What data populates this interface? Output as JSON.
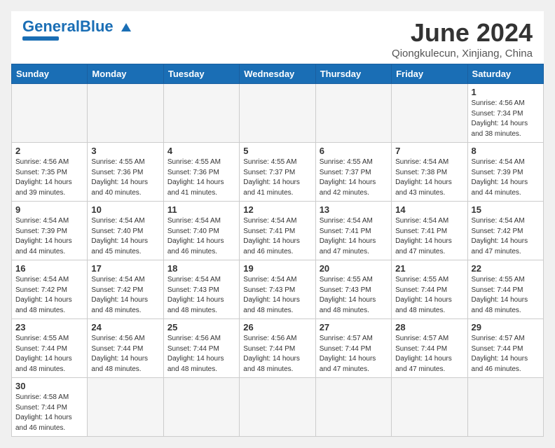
{
  "header": {
    "logo_general": "General",
    "logo_blue": "Blue",
    "title": "June 2024",
    "location": "Qiongkulecun, Xinjiang, China"
  },
  "weekdays": [
    "Sunday",
    "Monday",
    "Tuesday",
    "Wednesday",
    "Thursday",
    "Friday",
    "Saturday"
  ],
  "weeks": [
    [
      {
        "day": "",
        "info": ""
      },
      {
        "day": "",
        "info": ""
      },
      {
        "day": "",
        "info": ""
      },
      {
        "day": "",
        "info": ""
      },
      {
        "day": "",
        "info": ""
      },
      {
        "day": "",
        "info": ""
      },
      {
        "day": "1",
        "info": "Sunrise: 4:56 AM\nSunset: 7:34 PM\nDaylight: 14 hours\nand 38 minutes."
      }
    ],
    [
      {
        "day": "2",
        "info": "Sunrise: 4:56 AM\nSunset: 7:35 PM\nDaylight: 14 hours\nand 39 minutes."
      },
      {
        "day": "3",
        "info": "Sunrise: 4:55 AM\nSunset: 7:36 PM\nDaylight: 14 hours\nand 40 minutes."
      },
      {
        "day": "4",
        "info": "Sunrise: 4:55 AM\nSunset: 7:36 PM\nDaylight: 14 hours\nand 41 minutes."
      },
      {
        "day": "5",
        "info": "Sunrise: 4:55 AM\nSunset: 7:37 PM\nDaylight: 14 hours\nand 41 minutes."
      },
      {
        "day": "6",
        "info": "Sunrise: 4:55 AM\nSunset: 7:37 PM\nDaylight: 14 hours\nand 42 minutes."
      },
      {
        "day": "7",
        "info": "Sunrise: 4:54 AM\nSunset: 7:38 PM\nDaylight: 14 hours\nand 43 minutes."
      },
      {
        "day": "8",
        "info": "Sunrise: 4:54 AM\nSunset: 7:39 PM\nDaylight: 14 hours\nand 44 minutes."
      }
    ],
    [
      {
        "day": "9",
        "info": "Sunrise: 4:54 AM\nSunset: 7:39 PM\nDaylight: 14 hours\nand 44 minutes."
      },
      {
        "day": "10",
        "info": "Sunrise: 4:54 AM\nSunset: 7:40 PM\nDaylight: 14 hours\nand 45 minutes."
      },
      {
        "day": "11",
        "info": "Sunrise: 4:54 AM\nSunset: 7:40 PM\nDaylight: 14 hours\nand 46 minutes."
      },
      {
        "day": "12",
        "info": "Sunrise: 4:54 AM\nSunset: 7:41 PM\nDaylight: 14 hours\nand 46 minutes."
      },
      {
        "day": "13",
        "info": "Sunrise: 4:54 AM\nSunset: 7:41 PM\nDaylight: 14 hours\nand 47 minutes."
      },
      {
        "day": "14",
        "info": "Sunrise: 4:54 AM\nSunset: 7:41 PM\nDaylight: 14 hours\nand 47 minutes."
      },
      {
        "day": "15",
        "info": "Sunrise: 4:54 AM\nSunset: 7:42 PM\nDaylight: 14 hours\nand 47 minutes."
      }
    ],
    [
      {
        "day": "16",
        "info": "Sunrise: 4:54 AM\nSunset: 7:42 PM\nDaylight: 14 hours\nand 48 minutes."
      },
      {
        "day": "17",
        "info": "Sunrise: 4:54 AM\nSunset: 7:42 PM\nDaylight: 14 hours\nand 48 minutes."
      },
      {
        "day": "18",
        "info": "Sunrise: 4:54 AM\nSunset: 7:43 PM\nDaylight: 14 hours\nand 48 minutes."
      },
      {
        "day": "19",
        "info": "Sunrise: 4:54 AM\nSunset: 7:43 PM\nDaylight: 14 hours\nand 48 minutes."
      },
      {
        "day": "20",
        "info": "Sunrise: 4:55 AM\nSunset: 7:43 PM\nDaylight: 14 hours\nand 48 minutes."
      },
      {
        "day": "21",
        "info": "Sunrise: 4:55 AM\nSunset: 7:44 PM\nDaylight: 14 hours\nand 48 minutes."
      },
      {
        "day": "22",
        "info": "Sunrise: 4:55 AM\nSunset: 7:44 PM\nDaylight: 14 hours\nand 48 minutes."
      }
    ],
    [
      {
        "day": "23",
        "info": "Sunrise: 4:55 AM\nSunset: 7:44 PM\nDaylight: 14 hours\nand 48 minutes."
      },
      {
        "day": "24",
        "info": "Sunrise: 4:56 AM\nSunset: 7:44 PM\nDaylight: 14 hours\nand 48 minutes."
      },
      {
        "day": "25",
        "info": "Sunrise: 4:56 AM\nSunset: 7:44 PM\nDaylight: 14 hours\nand 48 minutes."
      },
      {
        "day": "26",
        "info": "Sunrise: 4:56 AM\nSunset: 7:44 PM\nDaylight: 14 hours\nand 48 minutes."
      },
      {
        "day": "27",
        "info": "Sunrise: 4:57 AM\nSunset: 7:44 PM\nDaylight: 14 hours\nand 47 minutes."
      },
      {
        "day": "28",
        "info": "Sunrise: 4:57 AM\nSunset: 7:44 PM\nDaylight: 14 hours\nand 47 minutes."
      },
      {
        "day": "29",
        "info": "Sunrise: 4:57 AM\nSunset: 7:44 PM\nDaylight: 14 hours\nand 46 minutes."
      }
    ],
    [
      {
        "day": "30",
        "info": "Sunrise: 4:58 AM\nSunset: 7:44 PM\nDaylight: 14 hours\nand 46 minutes."
      },
      {
        "day": "",
        "info": ""
      },
      {
        "day": "",
        "info": ""
      },
      {
        "day": "",
        "info": ""
      },
      {
        "day": "",
        "info": ""
      },
      {
        "day": "",
        "info": ""
      },
      {
        "day": "",
        "info": ""
      }
    ]
  ]
}
